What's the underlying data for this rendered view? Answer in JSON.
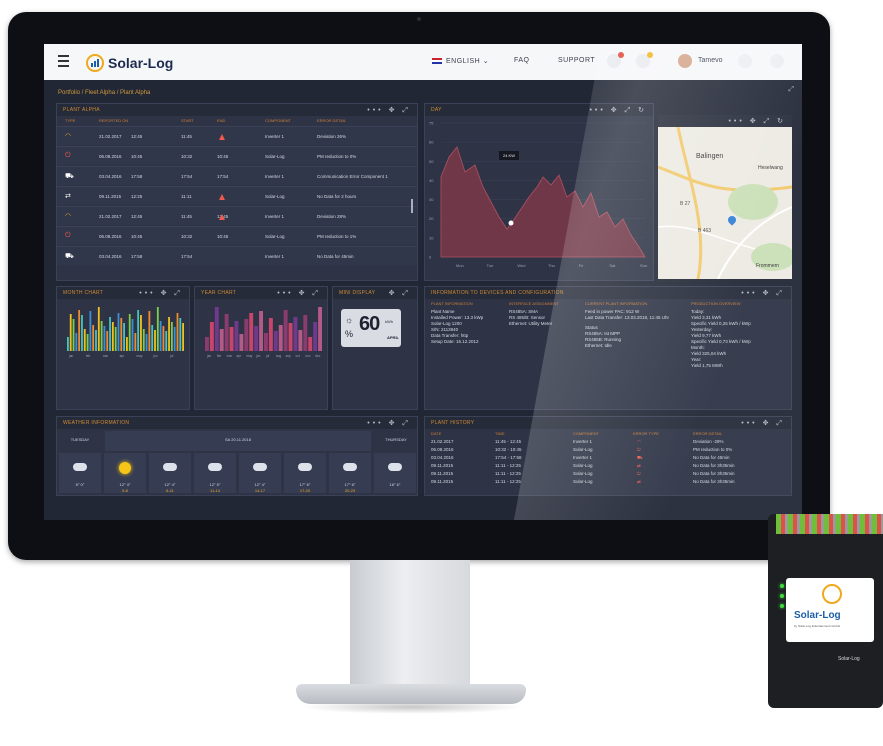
{
  "topbar": {
    "brand": "Solar-Log",
    "language": "ENGLISH",
    "faq": "FAQ",
    "support": "SUPPORT",
    "user": "Tamevo"
  },
  "breadcrumb": "Portfolio / Fleet Alpha / Plant Alpha",
  "plant_alpha": {
    "title": "PLANT ALPHA",
    "columns": [
      "TYPE",
      "REPORTED ON",
      "START",
      "END",
      "COMPONENT",
      "ERROR DETAIL"
    ],
    "rows": [
      {
        "icon": "gauge-icon",
        "date": "21.02.2017",
        "time": "12:45",
        "start": "11:45",
        "end": "",
        "component": "Inverter 1",
        "detail": "Deviation 26%"
      },
      {
        "icon": "power-icon",
        "date": "06.08.2016",
        "time": "10:45",
        "start": "10:32",
        "end": "10:45",
        "component": "Solar-Log",
        "detail": "PM reduction to 0%"
      },
      {
        "icon": "network-icon",
        "date": "03.04.2016",
        "time": "17:58",
        "start": "17:54",
        "end": "17:54",
        "component": "Inverter 1",
        "detail": "Communication Error Component 1"
      },
      {
        "icon": "swap-icon",
        "date": "09.11.2015",
        "time": "12:25",
        "start": "11:11",
        "end": "",
        "component": "Solar-Log",
        "detail": "No Data for 2 hours"
      },
      {
        "icon": "gauge-icon",
        "date": "21.02.2017",
        "time": "12:45",
        "start": "11:45",
        "end": "12:45",
        "component": "Inverter 1",
        "detail": "Deviation 28%"
      },
      {
        "icon": "power-icon",
        "date": "06.08.2016",
        "time": "10:45",
        "start": "10:32",
        "end": "10:45",
        "component": "Solar-Log",
        "detail": "PM reduction to 1%"
      },
      {
        "icon": "network-icon",
        "date": "03.04.2016",
        "time": "17:58",
        "start": "17:54",
        "end": "",
        "component": "Inverter 1",
        "detail": "No Data for 45min"
      }
    ]
  },
  "day_panel": {
    "title": "DAY",
    "tooltip": "24 KW",
    "y_ticks": [
      "75",
      "60",
      "50",
      "40",
      "30",
      "20",
      "10",
      "0"
    ],
    "x_ticks": [
      "Mon",
      "Tue",
      "Wed",
      "Thu",
      "Fri",
      "Sat",
      "Sun"
    ]
  },
  "map_labels": {
    "city1": "Balingen",
    "city2": "Heselwang",
    "road1": "B 27",
    "road2": "B 463",
    "town": "Frommern"
  },
  "month_chart": {
    "title": "MONTH CHART",
    "x_ticks": [
      "jan",
      "feb",
      "mar",
      "apr",
      "may",
      "jun",
      "jul"
    ]
  },
  "year_chart": {
    "title": "YEAR CHART",
    "x_ticks": [
      "jan",
      "feb",
      "mar",
      "apr",
      "may",
      "jun",
      "jul",
      "aug",
      "sep",
      "oct",
      "nov",
      "dec"
    ]
  },
  "mini_display": {
    "title": "MINI DISPLAY",
    "value": "60",
    "unit": "kWh",
    "sub": "APRIL"
  },
  "devices": {
    "title": "INFORMATION TO DEVICES AND CONFIGURATION",
    "col1_head": "PLANT INFORMATION",
    "col2_head": "INTERFACE ASSIGNMENT",
    "col3_head": "CURRENT PLANT INFORMATION",
    "col4_head": "PRODUCTION OVERVIEW",
    "plant_name": "Plant Name",
    "installed": "Installed Power: 13.3 kWp",
    "solarlog": "Solar-Log 1200",
    "sn": "S/N: 2113840",
    "transfer": "Data Transfer: http",
    "setup": "Setup Date: 15.12.2012",
    "iface1": "RS485A: SMA",
    "iface2": "RS 485/B: Sensor",
    "iface3": "Ethernet: Utility Meter",
    "feed": "Feed in power PAC: 912 W",
    "last": "Last Data Transfer: 13.03.2018, 11:45 Uhr",
    "status": "Status",
    "st1": "RS485A: Ist MPP",
    "st2": "RS485B: Running",
    "st3": "Ethernet: Idle",
    "today": "Today:",
    "t_yield": "Yield        3,31 kWh",
    "t_spec": "Specific Yield  0,25 kWh / kWp",
    "yesterday": "Yesterday:",
    "y_yield": "Yield        9,77 kWh",
    "y_spec": "Specific Yield  0,73 kWh / kWp",
    "month": "Month:",
    "m_yield": "Yield        325,04 kWh",
    "year": "Year:",
    "yr_yield": "Yield        1,75 MWh"
  },
  "weather": {
    "title": "WEATHER INFORMATION",
    "left_day": "TUESDAY",
    "center_day": "SA   20.11.2018",
    "right_day": "THURSDAY",
    "cells": [
      {
        "temp": "5° 0°",
        "range": ""
      },
      {
        "temp": "12° 4°",
        "range": "5-8"
      },
      {
        "temp": "12° 4°",
        "range": "8-11"
      },
      {
        "temp": "12° 5°",
        "range": "11-14"
      },
      {
        "temp": "12° 4°",
        "range": "14-17"
      },
      {
        "temp": "17° 6°",
        "range": "17-20"
      },
      {
        "temp": "17° 6°",
        "range": "20-23"
      },
      {
        "temp": "16° 6°",
        "range": ""
      }
    ]
  },
  "history": {
    "title": "PLANT HISTORY",
    "columns": [
      "DATE",
      "TIME",
      "COMPONENT",
      "ERROR TYPE",
      "ERROR DETAIL"
    ],
    "rows": [
      {
        "date": "21.02.2017",
        "time": "11:45 - 12:45",
        "component": "Inverter 1",
        "detail": "Deviation -28%"
      },
      {
        "date": "06.08.2016",
        "time": "10:32 - 10:45",
        "component": "Solar-Log",
        "detail": "PM reduction to 0%"
      },
      {
        "date": "03.04.2016",
        "time": "17:54 - 17:58",
        "component": "Inverter 1",
        "detail": "No Data for 45min"
      },
      {
        "date": "09.11.2015",
        "time": "11:11 - 12:25",
        "component": "Solar-Log",
        "detail": "No Data for 3h35min"
      },
      {
        "date": "09.11.2015",
        "time": "11:11 - 12:25",
        "component": "Solar-Log",
        "detail": "No Data for 3h35min"
      },
      {
        "date": "09.11.2015",
        "time": "11:11 - 12:25",
        "component": "Solar-Log",
        "detail": "No Data for 3h35min"
      }
    ]
  },
  "device_label": {
    "brand": "Solar-Log",
    "tag": "by Solar-Log Entertainment GmbH",
    "badge": "Solar-Log"
  },
  "colors": {
    "accent": "#d08a2f",
    "screen_bg": "#222736",
    "panel_bg": "#2e3446",
    "warn": "#f05a4e",
    "brand_blue": "#1b5fa8"
  }
}
